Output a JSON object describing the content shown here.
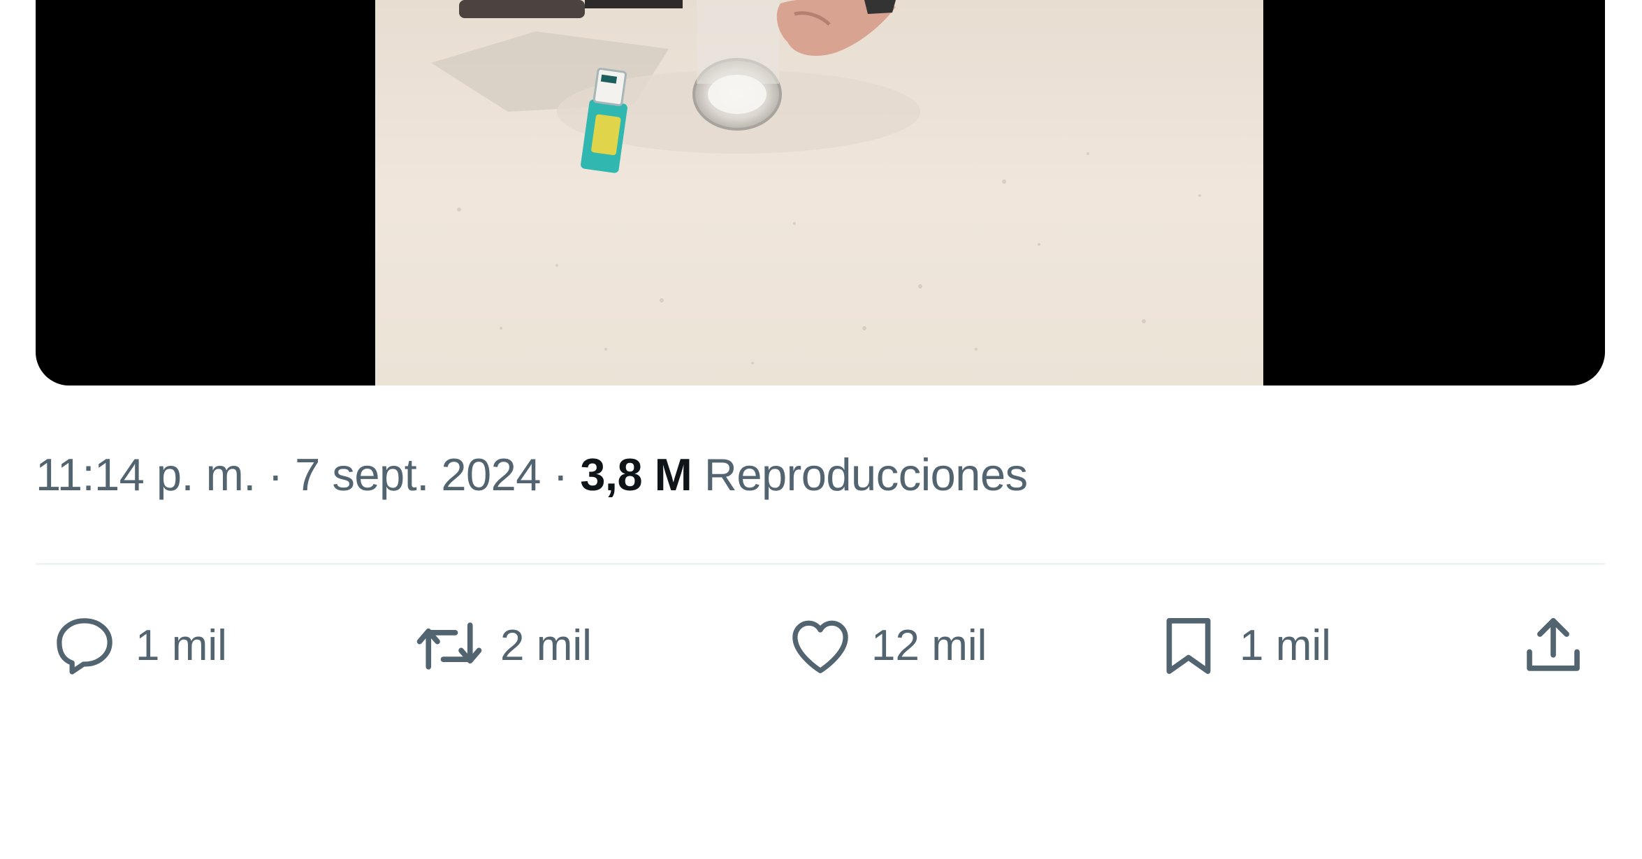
{
  "media": {
    "icon": "video-thumbnail"
  },
  "meta": {
    "time": "11:14 p. m.",
    "separator": "·",
    "date": "7 sept. 2024",
    "views_count": "3,8 M",
    "views_label": "Reproducciones"
  },
  "actions": {
    "reply": {
      "icon": "reply-icon",
      "count": "1 mil"
    },
    "repost": {
      "icon": "repost-icon",
      "count": "2 mil"
    },
    "like": {
      "icon": "heart-icon",
      "count": "12 mil"
    },
    "bookmark": {
      "icon": "bookmark-icon",
      "count": "1 mil"
    },
    "share": {
      "icon": "share-icon"
    }
  },
  "colors": {
    "text_secondary": "#536471",
    "text_primary": "#0f1419",
    "divider": "#eff3f4",
    "media_background": "#000000"
  }
}
